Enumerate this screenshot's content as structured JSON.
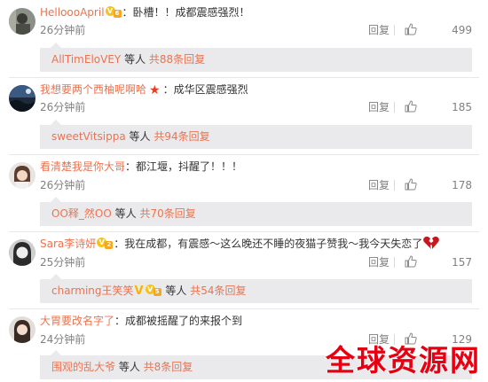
{
  "comments": [
    {
      "username": "HelloooApril",
      "badge_type": "level",
      "badge_level": "6",
      "separator": "：",
      "text": "卧槽！！成都震感强烈！",
      "time": "26分钟前",
      "reply_label": "回复",
      "likes": "499",
      "replies_user": "AllTimEloVEY",
      "replies_mid": " 等人 ",
      "replies_total": "共88条回复"
    },
    {
      "username": "我想要两个西柚呢啊哈",
      "badge_type": "star",
      "separator": "：",
      "text": "成华区震感强烈",
      "time": "26分钟前",
      "reply_label": "回复",
      "likes": "185",
      "replies_user": "sweetVitsippa",
      "replies_mid": " 等人 ",
      "replies_total": "共94条回复"
    },
    {
      "username": "看清楚我是你大哥",
      "badge_type": "none",
      "separator": "：",
      "text": "都江堰，抖醒了！！！",
      "time": "26分钟前",
      "reply_label": "回复",
      "likes": "178",
      "replies_user": "OO释_然OO",
      "replies_mid": " 等人 ",
      "replies_total": "共70条回复"
    },
    {
      "username": "Sara李诗妍",
      "badge_type": "level",
      "badge_level": "2",
      "separator": "：",
      "text": "我在成都，有震感～这么晚还不睡的夜猫子赞我～我今天失恋了",
      "time": "25分钟前",
      "reply_label": "回复",
      "likes": "157",
      "replies_user": "charming王笑笑",
      "replies_mid": " 等人 ",
      "replies_total": "共54条回复"
    },
    {
      "username": "大胃要改名字了",
      "badge_type": "none",
      "separator": "：",
      "text": "成都被摇醒了的来报个到",
      "time": "24分钟前",
      "reply_label": "回复",
      "likes": "129",
      "replies_user": "围观的乱大爷",
      "replies_mid": " 等人 ",
      "replies_total": "共8条回复"
    }
  ],
  "watermark": "全球资源网",
  "colors": {
    "link": "#eb7350",
    "gray": "#808080",
    "subbox": "#eaeaec",
    "watermark": "#e60012"
  }
}
